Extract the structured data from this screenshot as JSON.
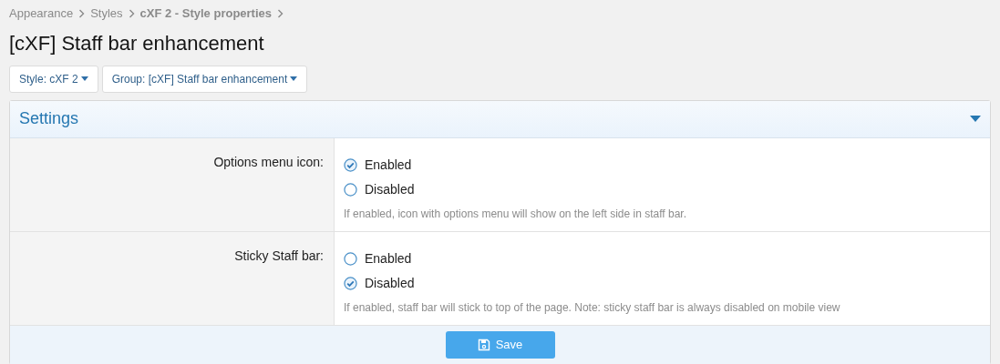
{
  "breadcrumb": [
    {
      "label": "Appearance",
      "bold": false
    },
    {
      "label": "Styles",
      "bold": false
    },
    {
      "label": "cXF 2 - Style properties",
      "bold": true
    }
  ],
  "title": "[cXF] Staff bar enhancement",
  "filters": [
    "Style: cXF 2",
    "Group: [cXF] Staff bar enhancement"
  ],
  "panel": {
    "title": "Settings",
    "expanded": true,
    "rows": [
      {
        "label": "Options menu icon:",
        "options": [
          {
            "label": "Enabled",
            "selected": true
          },
          {
            "label": "Disabled",
            "selected": false
          }
        ],
        "hint": "If enabled, icon with options menu will show on the left side in staff bar."
      },
      {
        "label": "Sticky Staff bar:",
        "options": [
          {
            "label": "Enabled",
            "selected": false
          },
          {
            "label": "Disabled",
            "selected": true
          }
        ],
        "hint": "If enabled, staff bar will stick to top of the page. Note: sticky staff bar is always disabled on mobile view"
      }
    ],
    "save": "Save"
  }
}
